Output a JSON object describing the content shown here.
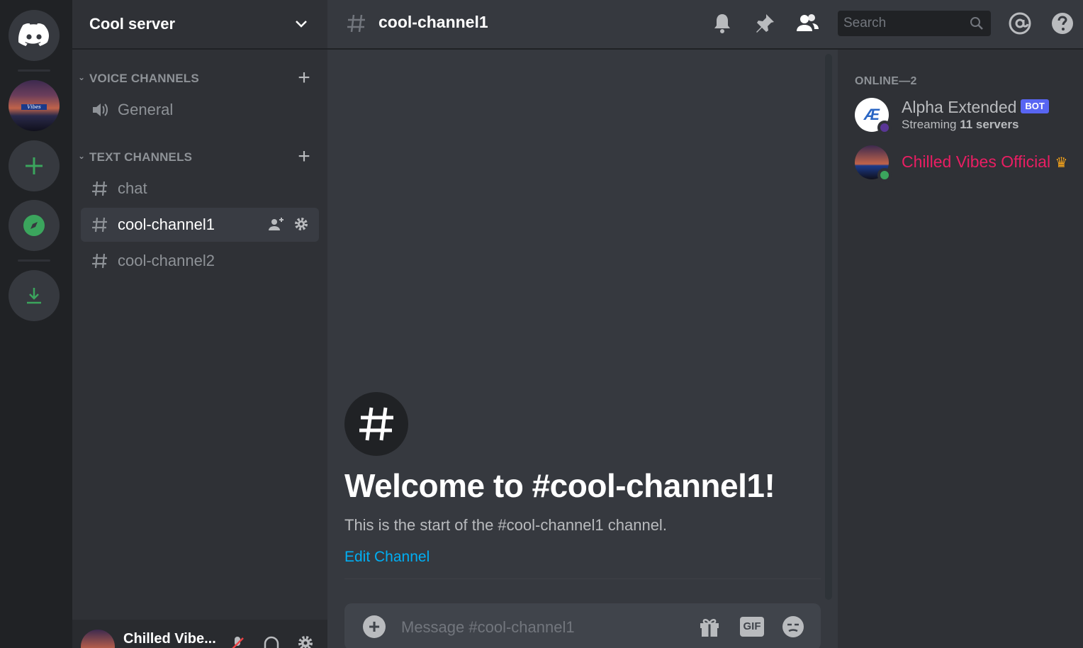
{
  "servers": {
    "items": [
      {
        "icon": "discord-logo-icon"
      },
      {
        "icon": "server-avatar",
        "banner_text": "Vibes"
      },
      {
        "icon": "add-server-icon"
      },
      {
        "icon": "explore-compass-icon"
      },
      {
        "icon": "download-icon"
      }
    ],
    "accent": "#3ba55d"
  },
  "guild": {
    "name": "Cool server"
  },
  "categories": {
    "voice": {
      "label": "VOICE CHANNELS",
      "channels": [
        {
          "name": "General"
        }
      ]
    },
    "text": {
      "label": "TEXT CHANNELS",
      "channels": [
        {
          "name": "chat"
        },
        {
          "name": "cool-channel1",
          "active": true
        },
        {
          "name": "cool-channel2"
        }
      ]
    }
  },
  "user_panel": {
    "name": "Chilled Vibe..."
  },
  "header": {
    "channel_name": "cool-channel1",
    "search_placeholder": "Search"
  },
  "welcome": {
    "title": "Welcome to #cool-channel1!",
    "subtitle": "This is the start of the #cool-channel1 channel.",
    "edit_link": "Edit Channel"
  },
  "composer": {
    "placeholder": "Message #cool-channel1",
    "gif_label": "GIF"
  },
  "members": {
    "header": "ONLINE—2",
    "list": [
      {
        "name": "Alpha Extended",
        "tag": "BOT",
        "activity_prefix": "Streaming ",
        "activity_bold": "11 servers",
        "name_color": "#b9bbbe",
        "status_color": "#593695",
        "avatar_text": "Æ"
      },
      {
        "name": "Chilled Vibes Official",
        "name_color": "#e91e63",
        "status_color": "#3ba55d",
        "crown": "♛"
      }
    ]
  },
  "colors": {
    "rail": "#202225",
    "sidebar": "#2f3136",
    "chat": "#36393f",
    "link": "#00aff4",
    "bot_tag": "#5865f2"
  }
}
